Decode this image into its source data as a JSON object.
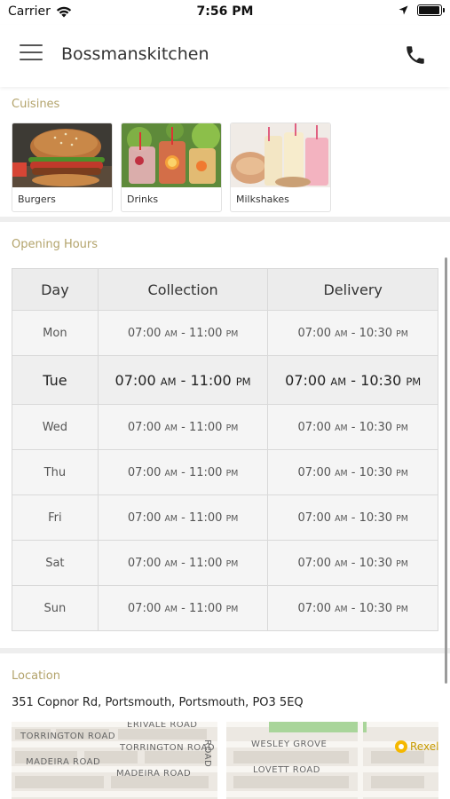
{
  "status_bar": {
    "carrier": "Carrier",
    "time": "7:56 PM",
    "battery_level": 0.9
  },
  "header": {
    "title": "Bossmanskitchen",
    "menu_icon": "hamburger-menu-icon",
    "phone_icon": "phone-icon"
  },
  "cuisines": {
    "title": "Cuisines",
    "items": [
      {
        "label": "Burgers"
      },
      {
        "label": "Drinks"
      },
      {
        "label": "Milkshakes"
      }
    ]
  },
  "opening_hours": {
    "title": "Opening Hours",
    "columns": [
      "Day",
      "Collection",
      "Delivery"
    ],
    "rows": [
      {
        "day": "Mon",
        "collection": {
          "open": "07:00",
          "open_ampm": "AM",
          "close": "11:00",
          "close_ampm": "PM"
        },
        "delivery": {
          "open": "07:00",
          "open_ampm": "AM",
          "close": "10:30",
          "close_ampm": "PM"
        }
      },
      {
        "day": "Tue",
        "collection": {
          "open": "07:00",
          "open_ampm": "AM",
          "close": "11:00",
          "close_ampm": "PM"
        },
        "delivery": {
          "open": "07:00",
          "open_ampm": "AM",
          "close": "10:30",
          "close_ampm": "PM"
        }
      },
      {
        "day": "Wed",
        "collection": {
          "open": "07:00",
          "open_ampm": "AM",
          "close": "11:00",
          "close_ampm": "PM"
        },
        "delivery": {
          "open": "07:00",
          "open_ampm": "AM",
          "close": "10:30",
          "close_ampm": "PM"
        }
      },
      {
        "day": "Thu",
        "collection": {
          "open": "07:00",
          "open_ampm": "AM",
          "close": "11:00",
          "close_ampm": "PM"
        },
        "delivery": {
          "open": "07:00",
          "open_ampm": "AM",
          "close": "10:30",
          "close_ampm": "PM"
        }
      },
      {
        "day": "Fri",
        "collection": {
          "open": "07:00",
          "open_ampm": "AM",
          "close": "11:00",
          "close_ampm": "PM"
        },
        "delivery": {
          "open": "07:00",
          "open_ampm": "AM",
          "close": "10:30",
          "close_ampm": "PM"
        }
      },
      {
        "day": "Sat",
        "collection": {
          "open": "07:00",
          "open_ampm": "AM",
          "close": "11:00",
          "close_ampm": "PM"
        },
        "delivery": {
          "open": "07:00",
          "open_ampm": "AM",
          "close": "10:30",
          "close_ampm": "PM"
        }
      },
      {
        "day": "Sun",
        "collection": {
          "open": "07:00",
          "open_ampm": "AM",
          "close": "11:00",
          "close_ampm": "PM"
        },
        "delivery": {
          "open": "07:00",
          "open_ampm": "AM",
          "close": "10:30",
          "close_ampm": "PM"
        }
      }
    ]
  },
  "location": {
    "title": "Location",
    "address": "351 Copnor Rd, Portsmouth, Portsmouth, PO3 5EQ",
    "map_labels": {
      "road1": "TORRINGTON ROAD",
      "road2": "TORRINGTON ROAD",
      "road3": "MADEIRA ROAD",
      "road4": "MADEIRA ROAD",
      "road5": "WESLEY GROVE",
      "road6": "LOVETT ROAD",
      "road7": "ROAD",
      "road8": "ERIVALE ROAD",
      "poi": "Rexel"
    }
  }
}
